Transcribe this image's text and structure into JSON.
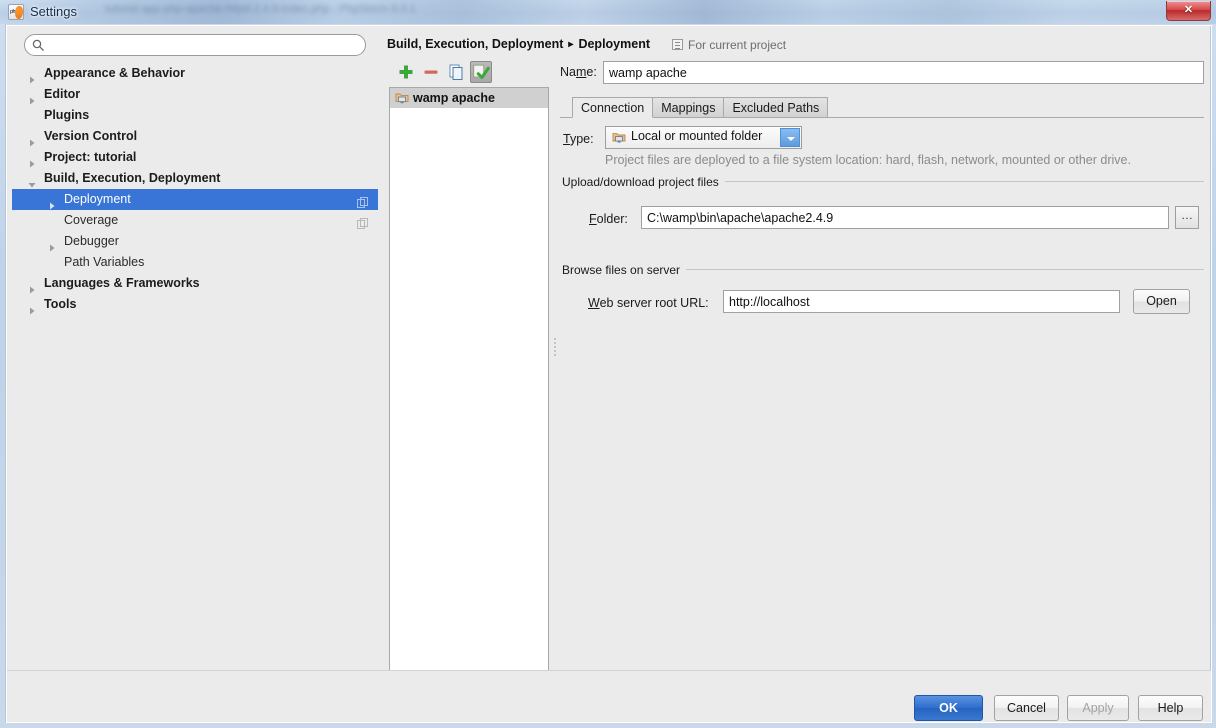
{
  "window": {
    "title": "Settings",
    "app_icon": "php-storm-icon",
    "close_label": "close-window",
    "blurred_background_text": "tutorial-app-php-apache-httpd-2.4.9-index.php  -  PhpStorm 9.0.1"
  },
  "search": {
    "placeholder": "",
    "value": "",
    "icon": "search-icon"
  },
  "sidebar": {
    "items": [
      {
        "label": "Appearance & Behavior",
        "level": 0,
        "expandable": true,
        "expanded": false,
        "selected": false,
        "badge": false
      },
      {
        "label": "Editor",
        "level": 0,
        "expandable": true,
        "expanded": false,
        "selected": false,
        "badge": false
      },
      {
        "label": "Plugins",
        "level": 0,
        "expandable": false,
        "expanded": false,
        "selected": false,
        "badge": false
      },
      {
        "label": "Version Control",
        "level": 0,
        "expandable": true,
        "expanded": false,
        "selected": false,
        "badge": false
      },
      {
        "label": "Project: tutorial",
        "level": 0,
        "expandable": true,
        "expanded": false,
        "selected": false,
        "badge": false
      },
      {
        "label": "Build, Execution, Deployment",
        "level": 0,
        "expandable": true,
        "expanded": true,
        "selected": false,
        "badge": false
      },
      {
        "label": "Deployment",
        "level": 1,
        "expandable": true,
        "expanded": false,
        "selected": true,
        "badge": true
      },
      {
        "label": "Coverage",
        "level": 1,
        "expandable": false,
        "expanded": false,
        "selected": false,
        "badge": true
      },
      {
        "label": "Debugger",
        "level": 1,
        "expandable": true,
        "expanded": false,
        "selected": false,
        "badge": false
      },
      {
        "label": "Path Variables",
        "level": 1,
        "expandable": false,
        "expanded": false,
        "selected": false,
        "badge": false
      },
      {
        "label": "Languages & Frameworks",
        "level": 0,
        "expandable": true,
        "expanded": false,
        "selected": false,
        "badge": false
      },
      {
        "label": "Tools",
        "level": 0,
        "expandable": true,
        "expanded": false,
        "selected": false,
        "badge": false
      }
    ]
  },
  "content": {
    "breadcrumb_root": "Build, Execution, Deployment",
    "breadcrumb_sep": "▸",
    "breadcrumb_leaf": "Deployment",
    "scope_label": "For current project",
    "scope_icon": "module-icon"
  },
  "toolbar": {
    "add_label": "add-server",
    "remove_label": "remove-server",
    "copy_label": "copy-server",
    "default_label": "use-as-default-server",
    "default_pressed": true
  },
  "server_list": {
    "items": [
      {
        "name": "wamp apache",
        "icon": "local-server-icon",
        "selected": true
      }
    ]
  },
  "form": {
    "name_label": "Name:",
    "name_label_mnemonic": "m",
    "name_value": "wamp apache",
    "tabs": [
      {
        "label": "Connection",
        "active": true
      },
      {
        "label": "Mappings",
        "active": false
      },
      {
        "label": "Excluded Paths",
        "active": false
      }
    ],
    "type_label": "Type:",
    "type_value": "Local or mounted folder",
    "type_icon": "local-folder-icon",
    "type_hint": "Project files are deployed to a file system location: hard, flash, network, mounted or other drive.",
    "group_upload_title": "Upload/download project files",
    "folder_label": "Folder:",
    "folder_value": "C:\\wamp\\bin\\apache\\apache2.4.9",
    "folder_browse_label": "…",
    "group_browse_title": "Browse files on server",
    "url_label": "Web server root URL:",
    "url_value": "http://localhost",
    "open_label": "Open"
  },
  "footer": {
    "ok_label": "OK",
    "cancel_label": "Cancel",
    "apply_label": "Apply",
    "apply_enabled": false,
    "help_label": "Help"
  },
  "colors": {
    "selection_blue": "#3875d7",
    "ok_button_blue": "#2f6fce",
    "dialog_bg": "#ebebeb",
    "list_header_gray": "#d0d0d0",
    "hint_gray": "#8b8b8b",
    "close_red": "#d84a4a"
  }
}
